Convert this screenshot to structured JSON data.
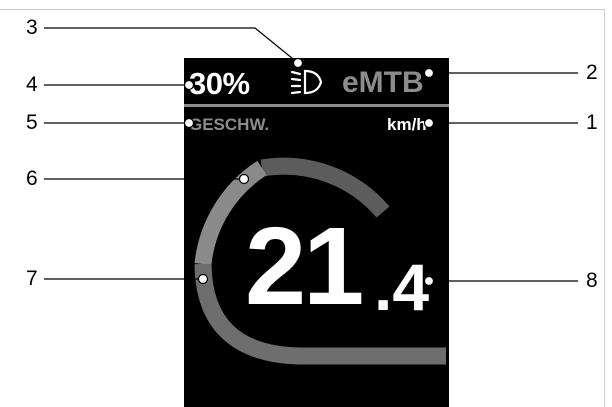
{
  "display": {
    "battery_percent": "30%",
    "assist_mode": "eMTB",
    "speed_label": "GESCHW.",
    "speed_unit": "km/h",
    "speed_integer": "21",
    "speed_decimal": ".4",
    "light_icon": "headlight-icon"
  },
  "callouts": {
    "n1": "1",
    "n2": "2",
    "n3": "3",
    "n4": "4",
    "n5": "5",
    "n6": "6",
    "n7": "7",
    "n8": "8"
  },
  "colors": {
    "screen_bg": "#000000",
    "text_primary": "#ffffff",
    "text_secondary": "#8c8c8c",
    "arc_light": "#8a8a8a",
    "arc_dark": "#5a5a5a",
    "arc_mid": "#6e6e6e"
  }
}
